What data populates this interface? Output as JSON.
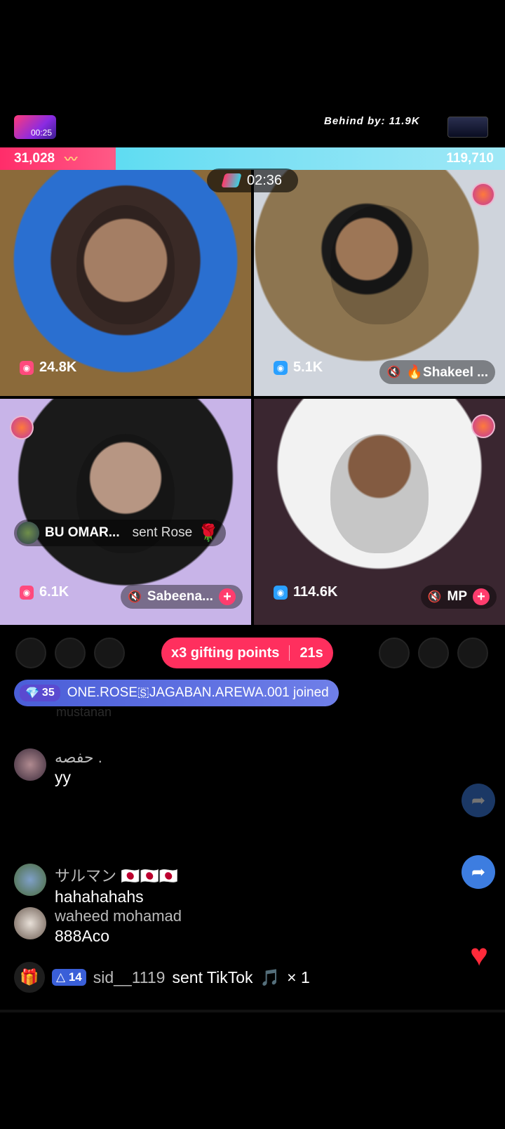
{
  "top": {
    "match_timer": "00:25",
    "behind_text": "Behind by: 11.9K"
  },
  "scores": {
    "left": "31,028",
    "right": "119,710"
  },
  "round_timer": "02:36",
  "tiles": [
    {
      "likes": "24.8K",
      "name": ""
    },
    {
      "likes": "5.1K",
      "name": "🔥Shakeel ..."
    },
    {
      "likes": "6.1K",
      "name": "Sabeena..."
    },
    {
      "likes": "114.6K",
      "name": "MP"
    }
  ],
  "gift_message": {
    "sender": "BU OMAR...",
    "action": "sent Rose"
  },
  "gifting_points": {
    "label": "x3 gifting points",
    "countdown": "21s"
  },
  "joined": {
    "level": "35",
    "text": "ONE.ROSE🇸JAGABAN.AREWA.001 joined"
  },
  "faded_text": "mustanan",
  "comments": [
    {
      "user": "‫. حفصه ‬",
      "message": "yy"
    },
    {
      "user": "サルマン 🇯🇵🇯🇵🇯🇵",
      "message": "hahahahahs"
    },
    {
      "user": "waheed mohamad",
      "message": "888Aco"
    }
  ],
  "gift_line": {
    "level": "14",
    "user": "sid__1119",
    "text": "sent TikTok",
    "count": "× 1"
  },
  "colors": {
    "accent": "#ff2f5e",
    "score_right": "#48d9f0",
    "share": "#3d7de0"
  }
}
